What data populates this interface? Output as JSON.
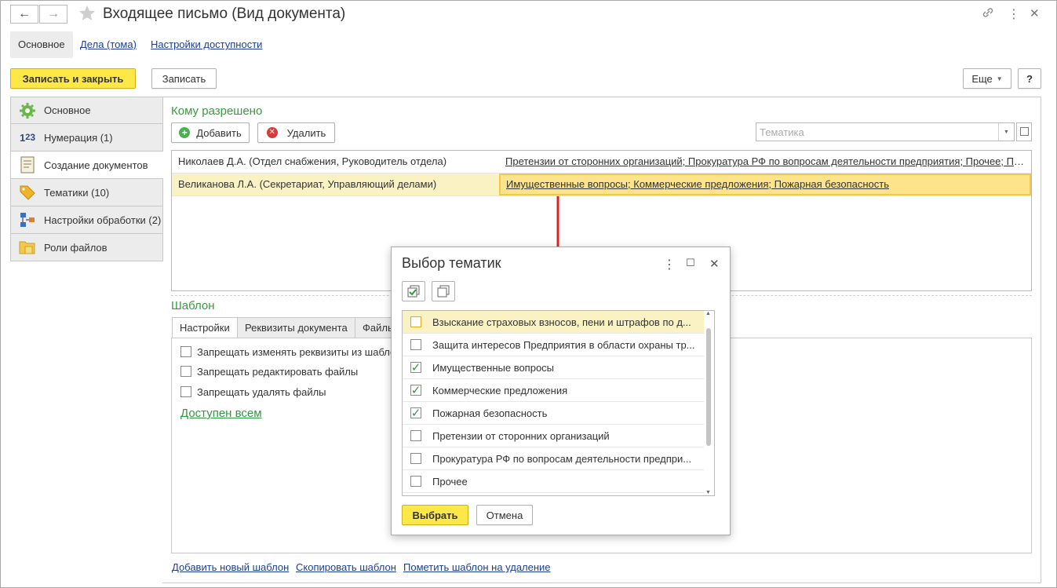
{
  "window": {
    "title": "Входящее письмо (Вид документа)",
    "back_label": "←",
    "forward_label": "→"
  },
  "top_tabs": [
    {
      "label": "Основное",
      "active": true
    },
    {
      "label": "Дела (тома)",
      "active": false
    },
    {
      "label": "Настройки доступности",
      "active": false
    }
  ],
  "toolbar": {
    "save_close_label": "Записать и закрыть",
    "save_label": "Записать",
    "more_label": "Еще",
    "help_label": "?"
  },
  "left_nav": [
    {
      "label": "Основное",
      "icon": "gear-icon"
    },
    {
      "label": "Нумерация (1)",
      "icon": "numbering-icon"
    },
    {
      "label": "Создание документов",
      "icon": "document-icon",
      "active": true
    },
    {
      "label": "Тематики (10)",
      "icon": "tag-icon"
    },
    {
      "label": "Настройки обработки (2)",
      "icon": "process-icon"
    },
    {
      "label": "Роли файлов",
      "icon": "folder-icon"
    }
  ],
  "allowed": {
    "title": "Кому разрешено",
    "add_label": "Добавить",
    "delete_label": "Удалить",
    "filter_placeholder": "Тематика",
    "rows": [
      {
        "person": "Николаев Д.А. (Отдел снабжения, Руководитель отдела)",
        "topics": "Претензии от сторонних организаций; Прокуратура РФ по вопросам деятельности предприятия; Прочее; По..."
      },
      {
        "person": "Великанова Л.А. (Секретариат, Управляющий делами)",
        "topics": "Имущественные вопросы; Коммерческие предложения; Пожарная безопасность"
      }
    ]
  },
  "template": {
    "title": "Шаблон",
    "tabs": [
      "Настройки",
      "Реквизиты документа",
      "Файлы"
    ],
    "options": [
      "Запрещать изменять реквизиты из шаблона",
      "Запрещать редактировать файлы",
      "Запрещать удалять файлы"
    ],
    "access_link": "Доступен всем"
  },
  "bottom_links": {
    "add": "Добавить новый шаблон",
    "copy": "Скопировать шаблон",
    "mark_delete": "Пометить шаблон на удаление"
  },
  "dialog": {
    "title": "Выбор тематик",
    "menu_icon": "⋮",
    "maximize_icon": "☐",
    "close_icon": "✕",
    "items": [
      {
        "label": "Взыскание страховых взносов, пени и штрафов по д...",
        "checked": false
      },
      {
        "label": "Защита интересов Предприятия в области охраны тр...",
        "checked": false
      },
      {
        "label": "Имущественные вопросы",
        "checked": true
      },
      {
        "label": "Коммерческие предложения",
        "checked": true
      },
      {
        "label": "Пожарная безопасность",
        "checked": true
      },
      {
        "label": "Претензии от сторонних организаций",
        "checked": false
      },
      {
        "label": "Прокуратура РФ по вопросам деятельности предпри...",
        "checked": false
      },
      {
        "label": "Прочее",
        "checked": false
      }
    ],
    "select_label": "Выбрать",
    "cancel_label": "Отмена"
  },
  "colors": {
    "accent_yellow": "#fde848",
    "section_green": "#3a9a3f",
    "arrow_red": "#e02020",
    "selection": "#fbf2c4"
  }
}
